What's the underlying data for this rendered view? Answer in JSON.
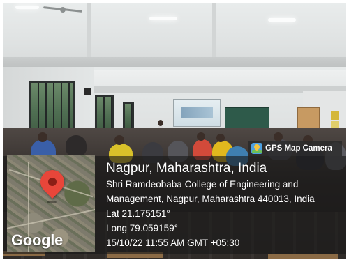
{
  "badge": {
    "label": "GPS Map Camera",
    "icon": "gps-map-camera-logo-icon"
  },
  "map": {
    "wordmark": "Google",
    "pin_icon": "map-pin-icon",
    "pin_color": "#e8463a"
  },
  "location": {
    "title": "Nagpur, Maharashtra, India",
    "address_line_1": "Shri Ramdeobaba College of Engineering and",
    "address_line_2": "Management, Nagpur, Maharashtra 440013, India",
    "latitude": "Lat 21.175151°",
    "longitude": "Long 79.059159°",
    "timestamp": "15/10/22 11:55 AM GMT +05:30"
  }
}
